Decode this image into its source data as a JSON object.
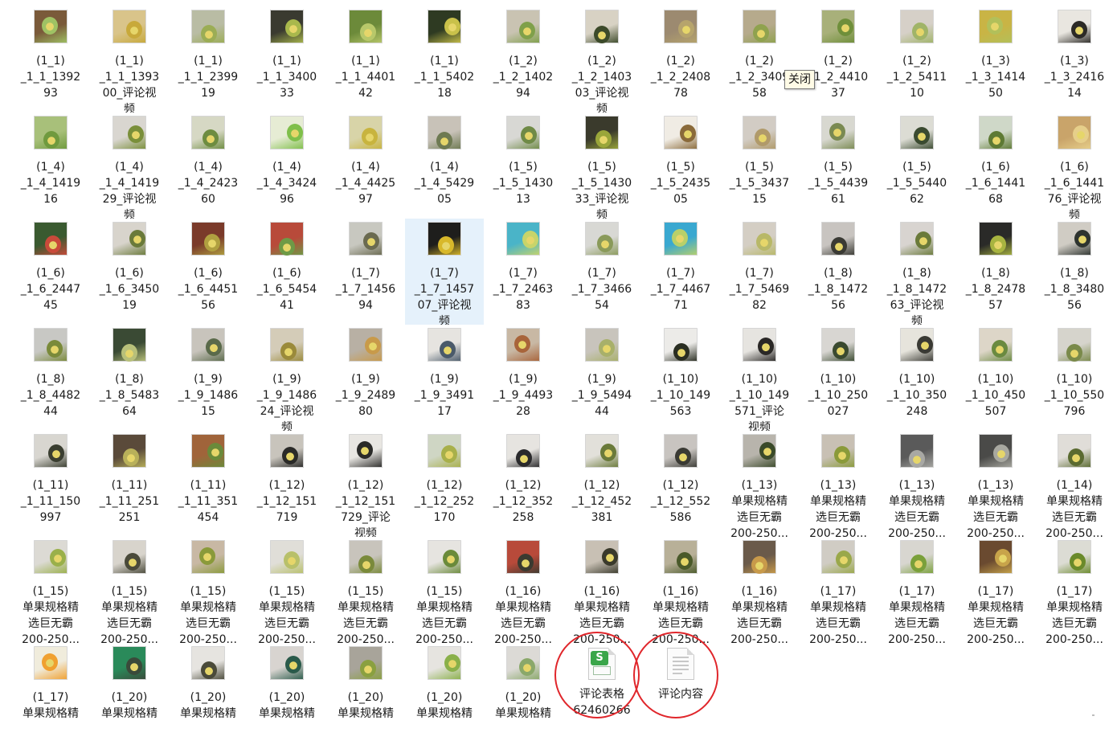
{
  "tooltip": "关闭",
  "selected_index": 33,
  "accent_colors": {
    "selection": "#e5f1fb",
    "highlight_circle": "#e0262b",
    "sheet_icon": "#3aa64a"
  },
  "files": [
    {
      "label": "(1_1)\n_1_1_1392\n93",
      "thumb": [
        "#7a5a3a",
        "#9fc264"
      ]
    },
    {
      "label": "(1_1)\n_1_1_1393\n00_评论视\n频",
      "thumb": [
        "#d9c48a",
        "#c8a93a"
      ]
    },
    {
      "label": "(1_1)\n_1_1_2399\n19",
      "thumb": [
        "#b9bca4",
        "#9bad55"
      ]
    },
    {
      "label": "(1_1)\n_1_1_3400\n33",
      "thumb": [
        "#3a3a30",
        "#a9b84c"
      ]
    },
    {
      "label": "(1_1)\n_1_1_4401\n42",
      "thumb": [
        "#6c8a3a",
        "#b8c86a"
      ]
    },
    {
      "label": "(1_1)\n_1_1_5402\n18",
      "thumb": [
        "#2e3a22",
        "#c9c14a"
      ]
    },
    {
      "label": "(1_2)\n_1_2_1402\n94",
      "thumb": [
        "#c9c3b2",
        "#7fa04a"
      ]
    },
    {
      "label": "(1_2)\n_1_2_1403\n03_评论视\n频",
      "thumb": [
        "#d8d2c4",
        "#3c4a2a"
      ]
    },
    {
      "label": "(1_2)\n_1_2_2408\n78",
      "thumb": [
        "#9c8a70",
        "#b6a46c"
      ]
    },
    {
      "label": "(1_2)\n_1_2_3409\n58",
      "thumb": [
        "#b6aa8c",
        "#8fa24e"
      ]
    },
    {
      "label": "(1_2)\n_1_2_4410\n37",
      "thumb": [
        "#a8b07a",
        "#6f8f3a"
      ]
    },
    {
      "label": "(1_2)\n_1_2_5411\n10",
      "thumb": [
        "#d6d0c8",
        "#a0b468"
      ]
    },
    {
      "label": "(1_3)\n_1_3_1414\n50",
      "thumb": [
        "#c9b445",
        "#b2c05a"
      ]
    },
    {
      "label": "(1_3)\n_1_3_2416\n14",
      "thumb": [
        "#e9e6e0",
        "#2c2a26"
      ]
    },
    {
      "label": "(1_4)\n_1_4_1419\n16",
      "thumb": [
        "#a8c07a",
        "#6f9a3e"
      ]
    },
    {
      "label": "(1_4)\n_1_4_1419\n29_评论视\n频",
      "thumb": [
        "#d9d6d0",
        "#7a8f3a"
      ]
    },
    {
      "label": "(1_4)\n_1_4_2423\n60",
      "thumb": [
        "#d6d8c4",
        "#6d8c40"
      ]
    },
    {
      "label": "(1_4)\n_1_4_3424\n96",
      "thumb": [
        "#e6ecd4",
        "#7fbf4a"
      ]
    },
    {
      "label": "(1_4)\n_1_4_4425\n97",
      "thumb": [
        "#d8d4a8",
        "#c8b43e"
      ]
    },
    {
      "label": "(1_4)\n_1_4_5429\n05",
      "thumb": [
        "#c8c2b8",
        "#6e7a52"
      ]
    },
    {
      "label": "(1_5)\n_1_5_1430\n13",
      "thumb": [
        "#d8d8d4",
        "#6f8a46"
      ]
    },
    {
      "label": "(1_5)\n_1_5_1430\n33_评论视\n频",
      "thumb": [
        "#3a3a2c",
        "#9aa63a"
      ]
    },
    {
      "label": "(1_5)\n_1_5_2435\n05",
      "thumb": [
        "#f0ece4",
        "#8a6a3a"
      ]
    },
    {
      "label": "(1_5)\n_1_5_3437\n15",
      "thumb": [
        "#d2ccc4",
        "#b09a6a"
      ]
    },
    {
      "label": "(1_5)\n_1_5_4439\n61",
      "thumb": [
        "#d8d8d0",
        "#7a8a52"
      ]
    },
    {
      "label": "(1_5)\n_1_5_5440\n62",
      "thumb": [
        "#dcdcd4",
        "#3a4a30"
      ]
    },
    {
      "label": "(1_6)\n_1_6_1441\n68",
      "thumb": [
        "#cfd8c8",
        "#5e7a34"
      ]
    },
    {
      "label": "(1_6)\n_1_6_1441\n76_评论视\n频",
      "thumb": [
        "#c9a46a",
        "#e6cf8a"
      ]
    },
    {
      "label": "(1_6)\n_1_6_2447\n45",
      "thumb": [
        "#3a5a30",
        "#c94a3a"
      ]
    },
    {
      "label": "(1_6)\n_1_6_3450\n19",
      "thumb": [
        "#d8d4cc",
        "#6a7a3a"
      ]
    },
    {
      "label": "(1_6)\n_1_6_4451\n56",
      "thumb": [
        "#7a3a2a",
        "#b0a040"
      ]
    },
    {
      "label": "(1_6)\n_1_6_5454\n41",
      "thumb": [
        "#b84a3a",
        "#6e9a46"
      ]
    },
    {
      "label": "(1_7)\n_1_7_1456\n94",
      "thumb": [
        "#c8c8c0",
        "#6a6a50"
      ]
    },
    {
      "label": "(1_7)\n_1_7_1457\n07_评论视\n频",
      "thumb": [
        "#1e1e1c",
        "#d8b82a"
      ]
    },
    {
      "label": "(1_7)\n_1_7_2463\n83",
      "thumb": [
        "#4ab4c8",
        "#c8d46a"
      ]
    },
    {
      "label": "(1_7)\n_1_7_3466\n54",
      "thumb": [
        "#d8d8d4",
        "#8a9a5a"
      ]
    },
    {
      "label": "(1_7)\n_1_7_4467\n71",
      "thumb": [
        "#3aa8d0",
        "#b8d06a"
      ]
    },
    {
      "label": "(1_7)\n_1_7_5469\n82",
      "thumb": [
        "#d4cec4",
        "#b8b868"
      ]
    },
    {
      "label": "(1_8)\n_1_8_1472\n56",
      "thumb": [
        "#c8c4c0",
        "#3a3a34"
      ]
    },
    {
      "label": "(1_8)\n_1_8_1472\n63_评论视\n频",
      "thumb": [
        "#d8d4d0",
        "#6a7a3a"
      ]
    },
    {
      "label": "(1_8)\n_1_8_2478\n57",
      "thumb": [
        "#2a2a28",
        "#a8b440"
      ]
    },
    {
      "label": "(1_8)\n_1_8_3480\n56",
      "thumb": [
        "#d0ccc4",
        "#2e3430"
      ]
    },
    {
      "label": "(1_8)\n_1_8_4482\n44",
      "thumb": [
        "#c8c8c4",
        "#7a8a3a"
      ]
    },
    {
      "label": "(1_8)\n_1_8_5483\n64",
      "thumb": [
        "#3a4a34",
        "#b8c07a"
      ]
    },
    {
      "label": "(1_9)\n_1_9_1486\n15",
      "thumb": [
        "#c8c4bc",
        "#5a6a4a"
      ]
    },
    {
      "label": "(1_9)\n_1_9_1486\n24_评论视\n频",
      "thumb": [
        "#d4ccb8",
        "#9a8a3a"
      ]
    },
    {
      "label": "(1_9)\n_1_9_2489\n80",
      "thumb": [
        "#b8b0a4",
        "#c89a4a"
      ]
    },
    {
      "label": "(1_9)\n_1_9_3491\n17",
      "thumb": [
        "#e6e4e0",
        "#4a5a6a"
      ]
    },
    {
      "label": "(1_9)\n_1_9_4493\n28",
      "thumb": [
        "#c8b8a4",
        "#a8643a"
      ]
    },
    {
      "label": "(1_9)\n_1_9_5494\n44",
      "thumb": [
        "#c8c4bc",
        "#a8b06a"
      ]
    },
    {
      "label": "(1_10)\n_1_10_149\n563",
      "thumb": [
        "#ecebe8",
        "#2a2e22"
      ]
    },
    {
      "label": "(1_10)\n_1_10_149\n571_评论\n视频",
      "thumb": [
        "#e6e4e0",
        "#2a2826"
      ]
    },
    {
      "label": "(1_10)\n_1_10_250\n027",
      "thumb": [
        "#d8d6d2",
        "#3a4a30"
      ]
    },
    {
      "label": "(1_10)\n_1_10_350\n248",
      "thumb": [
        "#e6e4dc",
        "#3a3a34"
      ]
    },
    {
      "label": "(1_10)\n_1_10_450\n507",
      "thumb": [
        "#ddd6c8",
        "#6a8a40"
      ]
    },
    {
      "label": "(1_10)\n_1_10_550\n796",
      "thumb": [
        "#d6d4cc",
        "#7a8a4a"
      ]
    },
    {
      "label": "(1_11)\n_1_11_150\n997",
      "thumb": [
        "#d8d6d0",
        "#3a3e30"
      ]
    },
    {
      "label": "(1_11)\n_1_11_251\n251",
      "thumb": [
        "#5a4a3a",
        "#b8b05a"
      ]
    },
    {
      "label": "(1_11)\n_1_11_351\n454",
      "thumb": [
        "#a0643a",
        "#6a8a3a"
      ]
    },
    {
      "label": "(1_12)\n_1_12_151\n719",
      "thumb": [
        "#c8c4bc",
        "#2a2a28"
      ]
    },
    {
      "label": "(1_12)\n_1_12_151\n729_评论\n视频",
      "thumb": [
        "#e8e6e2",
        "#2a2a28"
      ]
    },
    {
      "label": "(1_12)\n_1_12_252\n170",
      "thumb": [
        "#cfd6c4",
        "#a8b04a"
      ]
    },
    {
      "label": "(1_12)\n_1_12_352\n258",
      "thumb": [
        "#e6e4e0",
        "#2a2a2c"
      ]
    },
    {
      "label": "(1_12)\n_1_12_452\n381",
      "thumb": [
        "#e2e0da",
        "#6a7a3a"
      ]
    },
    {
      "label": "(1_12)\n_1_12_552\n586",
      "thumb": [
        "#c8c4c0",
        "#3a3a34"
      ]
    },
    {
      "label": "(1_13)\n单果规格精\n选巨无霸\n200-250...",
      "thumb": [
        "#b8b4ac",
        "#3a4a2a"
      ]
    },
    {
      "label": "(1_13)\n单果规格精\n选巨无霸\n200-250...",
      "thumb": [
        "#c8c0b4",
        "#8a9a3a"
      ]
    },
    {
      "label": "(1_13)\n单果规格精\n选巨无霸\n200-250...",
      "thumb": [
        "#5a5a5a",
        "#a8a8a4"
      ]
    },
    {
      "label": "(1_13)\n单果规格精\n选巨无霸\n200-250...",
      "thumb": [
        "#4a4a48",
        "#a8a8a0"
      ]
    },
    {
      "label": "(1_14)\n单果规格精\n选巨无霸\n200-250...",
      "thumb": [
        "#e0ddd8",
        "#5a6a30"
      ]
    },
    {
      "label": "(1_15)\n单果规格精\n选巨无霸\n200-250...",
      "thumb": [
        "#dcdad4",
        "#9ab04a"
      ]
    },
    {
      "label": "(1_15)\n单果规格精\n选巨无霸\n200-250...",
      "thumb": [
        "#d8d4cc",
        "#4a4a3a"
      ]
    },
    {
      "label": "(1_15)\n单果规格精\n选巨无霸\n200-250...",
      "thumb": [
        "#c8b8a4",
        "#8a9a3a"
      ]
    },
    {
      "label": "(1_15)\n单果规格精\n选巨无霸\n200-250...",
      "thumb": [
        "#e0ded8",
        "#b8c06a"
      ]
    },
    {
      "label": "(1_15)\n单果规格精\n选巨无霸\n200-250...",
      "thumb": [
        "#c8c4bc",
        "#7a8a3a"
      ]
    },
    {
      "label": "(1_15)\n单果规格精\n选巨无霸\n200-250...",
      "thumb": [
        "#e6e4e0",
        "#6a8a3a"
      ]
    },
    {
      "label": "(1_16)\n单果规格精\n选巨无霸\n200-250...",
      "thumb": [
        "#b84a3a",
        "#3a3a30"
      ]
    },
    {
      "label": "(1_16)\n单果规格精\n选巨无霸\n200-250...",
      "thumb": [
        "#c8c0b4",
        "#3a3a2c"
      ]
    },
    {
      "label": "(1_16)\n单果规格精\n选巨无霸\n200-250...",
      "thumb": [
        "#b8b098",
        "#4a5a2a"
      ]
    },
    {
      "label": "(1_16)\n单果规格精\n选巨无霸\n200-250...",
      "thumb": [
        "#6a5a4a",
        "#c89a4a"
      ]
    },
    {
      "label": "(1_17)\n单果规格精\n选巨无霸\n200-250...",
      "thumb": [
        "#d0ccc4",
        "#9aa84a"
      ]
    },
    {
      "label": "(1_17)\n单果规格精\n选巨无霸\n200-250...",
      "thumb": [
        "#d8d6d0",
        "#7aa03a"
      ]
    },
    {
      "label": "(1_17)\n单果规格精\n选巨无霸\n200-250...",
      "thumb": [
        "#6a4a30",
        "#c8a44a"
      ]
    },
    {
      "label": "(1_17)\n单果规格精\n选巨无霸\n200-250...",
      "thumb": [
        "#dcdcd4",
        "#6a8a2a"
      ]
    },
    {
      "label": "(1_17)\n单果规格精",
      "thumb": [
        "#f0ecdc",
        "#f0a030"
      ]
    },
    {
      "label": "(1_20)\n单果规格精",
      "thumb": [
        "#2a8a5a",
        "#3a4a3a"
      ]
    },
    {
      "label": "(1_20)\n单果规格精",
      "thumb": [
        "#e6e4e0",
        "#4a4a3a"
      ]
    },
    {
      "label": "(1_20)\n单果规格精",
      "thumb": [
        "#d8d4d0",
        "#2a5a4a"
      ]
    },
    {
      "label": "(1_20)\n单果规格精",
      "thumb": [
        "#a8a49a",
        "#8aa040"
      ]
    },
    {
      "label": "(1_20)\n单果规格精",
      "thumb": [
        "#e6e4e0",
        "#8ab04a"
      ]
    },
    {
      "label": "(1_20)\n单果规格精",
      "thumb": [
        "#dcdad6",
        "#8aa86a"
      ]
    },
    {
      "label": "评论表格\n62460266",
      "kind": "spreadsheet",
      "icon": "spreadsheet-icon",
      "circled": true
    },
    {
      "label": "评论内容",
      "kind": "text",
      "icon": "text-file-icon",
      "circled": true
    }
  ]
}
